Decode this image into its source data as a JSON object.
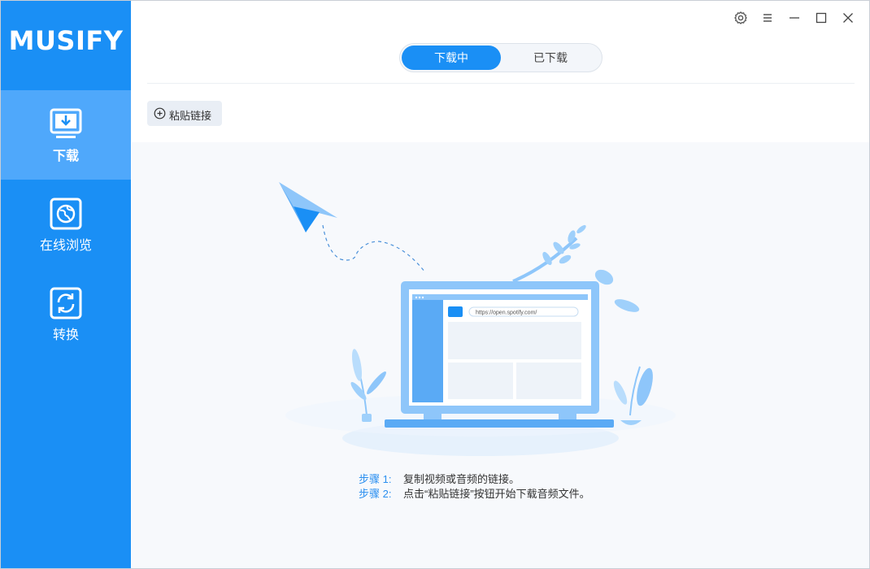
{
  "app": {
    "brand": "MUSIFY"
  },
  "sidebar": {
    "items": [
      {
        "label": "下载",
        "icon": "download-icon",
        "active": true
      },
      {
        "label": "在线浏览",
        "icon": "globe-icon",
        "active": false
      },
      {
        "label": "转换",
        "icon": "convert-icon",
        "active": false
      }
    ]
  },
  "titlebar": {
    "icons": [
      "settings-icon",
      "menu-icon",
      "minimize-icon",
      "maximize-icon",
      "close-icon"
    ]
  },
  "tabs": {
    "downloading": "下载中",
    "downloaded": "已下载"
  },
  "toolbar": {
    "paste_label": "粘贴链接"
  },
  "illustration": {
    "url": "https://open.spotify.com/"
  },
  "steps": [
    {
      "label": "步骤 1:",
      "text": "复制视频或音频的链接。"
    },
    {
      "label": "步骤 2:",
      "text": "点击“粘贴链接”按钮开始下载音频文件。"
    }
  ],
  "colors": {
    "accent": "#1a8ff5",
    "accent_light": "#4fa8fb",
    "step_label": "#2a8ff0"
  }
}
